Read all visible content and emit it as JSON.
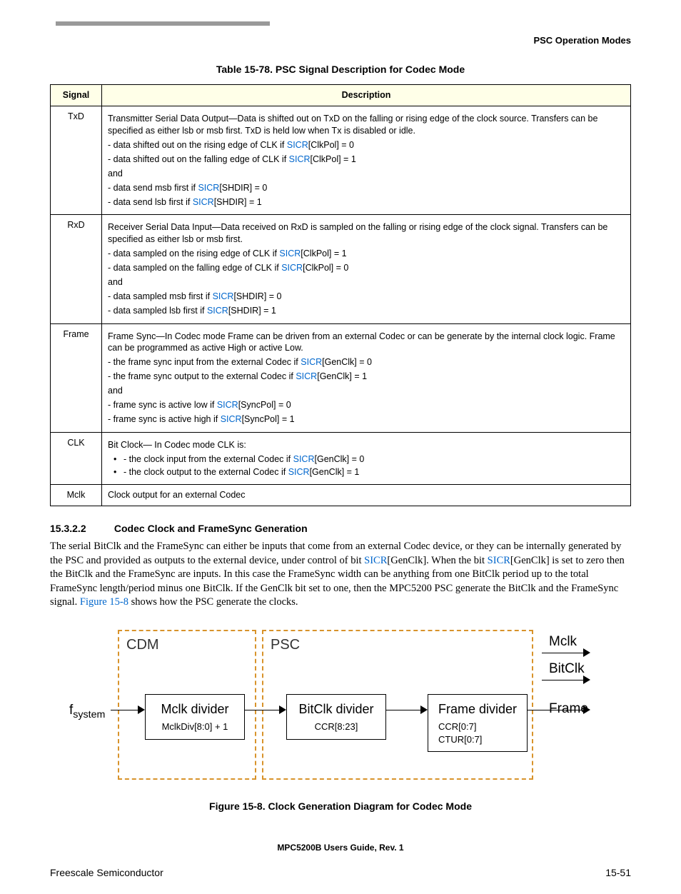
{
  "running_head": "PSC Operation Modes",
  "table_caption": "Table 15-78. PSC Signal Description for Codec Mode",
  "table_header": {
    "signal": "Signal",
    "description": "Description"
  },
  "rows": {
    "txd": {
      "sig": "TxD",
      "intro": "Transmitter Serial Data Output—Data is shifted out on TxD on the falling or rising edge of the clock source. Transfers can be specified as either lsb or msb first. TxD is held low when Tx is disabled or idle.",
      "l1a": "- data shifted out on the rising edge of CLK if ",
      "l1b": "[ClkPol] = 0",
      "l2a": "- data shifted out on the falling edge of CLK if ",
      "l2b": "[ClkPol] = 1",
      "and": "and",
      "l3a": "- data send msb first if ",
      "l3b": "[SHDIR] = 0",
      "l4a": "- data send lsb first if ",
      "l4b": "[SHDIR] = 1"
    },
    "rxd": {
      "sig": "RxD",
      "intro": "Receiver Serial Data Input—Data received on RxD is sampled on the falling or rising edge of the clock signal. Transfers can be specified as either lsb or msb first.",
      "l1a": "- data sampled on the rising edge of CLK if ",
      "l1b": "[ClkPol] = 1",
      "l2a": "- data sampled on the falling edge of CLK if ",
      "l2b": "[ClkPol] = 0",
      "and": "and",
      "l3a": "- data sampled msb first if ",
      "l3b": "[SHDIR] = 0",
      "l4a": "- data sampled lsb first if ",
      "l4b": "[SHDIR] = 1"
    },
    "frame": {
      "sig": "Frame",
      "intro": "Frame Sync—In Codec mode Frame can be driven from an external Codec or can be generate by the internal clock logic. Frame can be programmed as active High or active Low.",
      "l1a": "- the frame sync input from the external Codec if ",
      "l1b": "[GenClk] = 0",
      "l2a": "- the frame sync output to the external Codec if ",
      "l2b": "[GenClk] = 1",
      "and": "and",
      "l3a": "- frame sync is active low if ",
      "l3b": "[SyncPol] = 0",
      "l4a": "- frame sync is active high if ",
      "l4b": "[SyncPol] = 1"
    },
    "clk": {
      "sig": "CLK",
      "intro": "Bit Clock— In Codec mode CLK is:",
      "b1a": "- the clock input from the external Codec if ",
      "b1b": "[GenClk] = 0",
      "b2a": "- the clock output to the external Codec if ",
      "b2b": "[GenClk] = 1"
    },
    "mclk": {
      "sig": "Mclk",
      "d": "Clock output for an external Codec"
    }
  },
  "sicr": "SICR",
  "section": {
    "num": "15.3.2.2",
    "title": "Codec Clock and FrameSync Generation"
  },
  "para": {
    "t1": "The serial BitClk and the FrameSync can either be inputs that come from an external Codec device, or they can be internally generated by the PSC and provided as outputs to the external device, under control of bit ",
    "t2": "[GenClk]. When the bit ",
    "t3": "[GenClk] is set to zero then the BitClk and the FrameSync are inputs. In this case the FrameSync width can be anything from one BitClk period up to the total FrameSync length/period minus one BitClk. If the GenClk bit set to one, then the MPC5200 PSC generate the BitClk and the FrameSync signal. ",
    "figref": "Figure 15-8",
    "t4": " shows how the PSC generate the clocks."
  },
  "diagram": {
    "cdm": "CDM",
    "psc": "PSC",
    "fsystem": "f",
    "fsystem_sub": "system",
    "mclk_div": "Mclk divider",
    "mclk_sub": "MclkDiv[8:0] + 1",
    "bitclk_div": "BitClk divider",
    "bitclk_sub": "CCR[8:23]",
    "frame_div": "Frame divider",
    "frame_sub1": "CCR[0:7]",
    "frame_sub2": "CTUR[0:7]",
    "out_mclk": "Mclk",
    "out_bitclk": "BitClk",
    "out_frame": "Frame"
  },
  "fig_caption": "Figure 15-8. Clock Generation Diagram for Codec Mode",
  "footer_center": "MPC5200B Users Guide, Rev. 1",
  "footer_left": "Freescale Semiconductor",
  "footer_right": "15-51"
}
